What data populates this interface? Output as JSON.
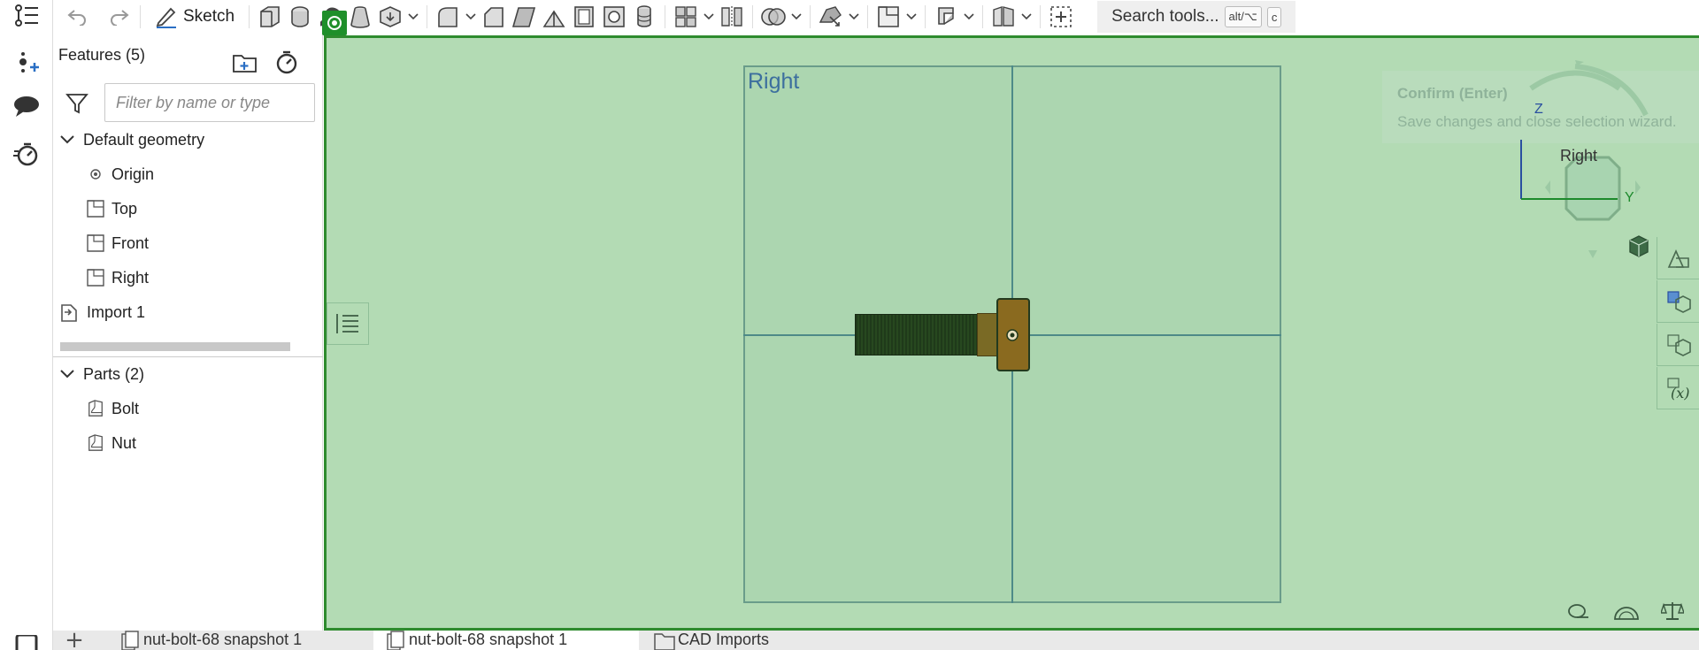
{
  "toolbar": {
    "sketch_label": "Sketch",
    "search_label": "Search tools...",
    "search_shortcut_mod": "alt/⌥",
    "search_shortcut_key": "c"
  },
  "panel": {
    "title": "Features (5)",
    "filter_placeholder": "Filter by name or type",
    "default_geometry_label": "Default geometry",
    "items": [
      {
        "label": "Origin",
        "icon": "origin-icon"
      },
      {
        "label": "Top",
        "icon": "plane-icon"
      },
      {
        "label": "Front",
        "icon": "plane-icon"
      },
      {
        "label": "Right",
        "icon": "plane-icon"
      }
    ],
    "import_label": "Import 1",
    "parts_label": "Parts (2)",
    "parts": [
      {
        "label": "Bolt",
        "icon": "part-icon"
      },
      {
        "label": "Nut",
        "icon": "part-icon"
      }
    ]
  },
  "viewport": {
    "plane_label": "Right",
    "confirm_title": "Confirm (Enter)",
    "confirm_desc": "Save changes and close selection wizard.",
    "viewcube_face": "Right",
    "axis_z": "Z",
    "axis_y": "Y"
  },
  "tabs": [
    {
      "label": "nut-bolt-68 snapshot 1",
      "active": false
    },
    {
      "label": "nut-bolt-68 snapshot 1",
      "active": true
    },
    {
      "label": "CAD Imports",
      "active": false
    }
  ],
  "colors": {
    "viewport_bg": "#b3dbb4",
    "viewport_border": "#2e8b2e",
    "plane_label": "#3c6f9e"
  }
}
